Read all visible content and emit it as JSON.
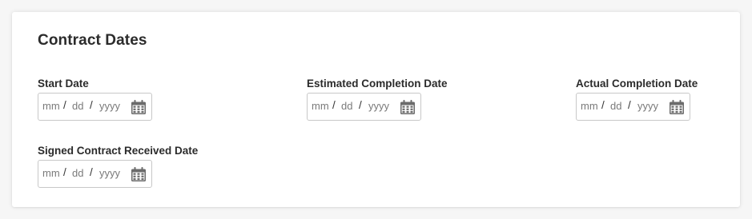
{
  "section": {
    "title": "Contract Dates"
  },
  "fields": [
    {
      "label": "Start Date",
      "placeholder": {
        "month": "mm",
        "day": "dd",
        "year": "yyyy",
        "separator": "/"
      },
      "icon": "calendar-icon"
    },
    {
      "label": "Estimated Completion Date",
      "placeholder": {
        "month": "mm",
        "day": "dd",
        "year": "yyyy",
        "separator": "/"
      },
      "icon": "calendar-icon"
    },
    {
      "label": "Actual Completion Date",
      "placeholder": {
        "month": "mm",
        "day": "dd",
        "year": "yyyy",
        "separator": "/"
      },
      "icon": "calendar-icon"
    },
    {
      "label": "Signed Contract Received Date",
      "placeholder": {
        "month": "mm",
        "day": "dd",
        "year": "yyyy",
        "separator": "/"
      },
      "icon": "calendar-icon"
    }
  ],
  "colors": {
    "card_background": "#ffffff",
    "page_background": "#f6f6f6",
    "input_border": "#c8c8c8",
    "placeholder_text": "#7a7a7a",
    "calendar_icon": "#6b6b6b"
  }
}
